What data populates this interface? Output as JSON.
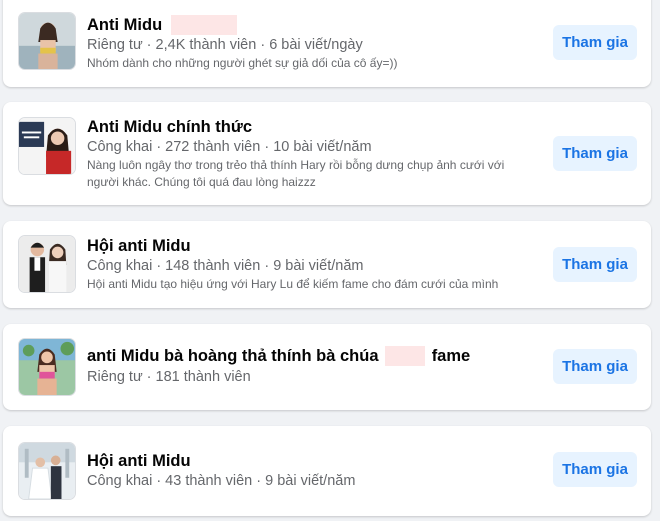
{
  "groups": [
    {
      "name": "Anti Midu",
      "meta": "Riêng tư · 2,4K thành viên · 6 bài viết/ngày",
      "description": "Nhóm dành cho những người ghét sự giả dối của cô ấy=))",
      "join_label": "Tham gia",
      "avatar_icon": "group-avatar-photo"
    },
    {
      "name": "Anti Midu chính thức",
      "meta": "Công khai · 272 thành viên · 10 bài viết/năm",
      "description": "Nàng luôn ngây thơ trong trẻo thả thính Hary rồi bỗng dưng chụp ảnh cưới với người khác. Chúng tôi quá đau lòng haizzz",
      "join_label": "Tham gia",
      "avatar_icon": "group-avatar-photo"
    },
    {
      "name": "Hội anti Midu",
      "meta": "Công khai · 148 thành viên · 9 bài viết/năm",
      "description": "Hội anti Midu tạo hiệu ứng với Hary Lu để kiếm fame cho đám cưới của mình",
      "join_label": "Tham gia",
      "avatar_icon": "group-avatar-photo"
    },
    {
      "name_prefix": "anti Midu bà hoàng thả thính bà chúa",
      "name_suffix": "fame",
      "meta": "Riêng tư · 181 thành viên",
      "join_label": "Tham gia",
      "avatar_icon": "group-avatar-photo"
    },
    {
      "name": "Hội anti Midu",
      "meta": "Công khai · 43 thành viên · 9 bài viết/năm",
      "join_label": "Tham gia",
      "avatar_icon": "group-avatar-photo"
    }
  ],
  "colors": {
    "background": "#f0f2f5",
    "card": "#ffffff",
    "button_bg": "#e7f3ff",
    "button_text": "#1b74e4",
    "meta_text": "#65676b",
    "redaction": "#fde6e6"
  }
}
